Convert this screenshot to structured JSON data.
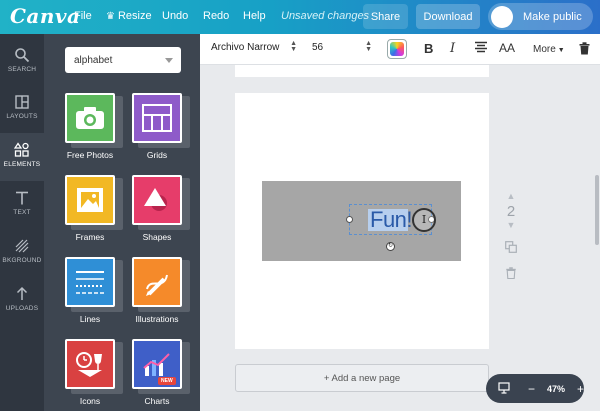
{
  "app": {
    "logo": "Canva"
  },
  "topbar": {
    "file": "File",
    "resize": "Resize",
    "undo": "Undo",
    "redo": "Redo",
    "help": "Help",
    "status": "Unsaved changes",
    "share": "Share",
    "download": "Download",
    "make_public": "Make public"
  },
  "rail": {
    "search": "SEARCH",
    "layouts": "LAYOUTS",
    "elements": "ELEMENTS",
    "text": "TEXT",
    "bkground": "BKGROUND",
    "uploads": "UPLOADS"
  },
  "panel": {
    "search_value": "alphabet",
    "tiles": {
      "photos": "Free Photos",
      "grids": "Grids",
      "frames": "Frames",
      "shapes": "Shapes",
      "lines": "Lines",
      "illustrations": "Illustrations",
      "icons": "Icons",
      "charts": "Charts",
      "new_badge": "NEW"
    }
  },
  "toolbar": {
    "font": "Archivo Narrow",
    "size": "56",
    "bold": "B",
    "italic": "I",
    "case": "AA",
    "more": "More"
  },
  "canvas": {
    "text_content": "Fun!",
    "page_number": "2",
    "add_page": "+ Add a new page",
    "zoom": "47%",
    "zoom_minus": "−",
    "zoom_plus": "+"
  }
}
